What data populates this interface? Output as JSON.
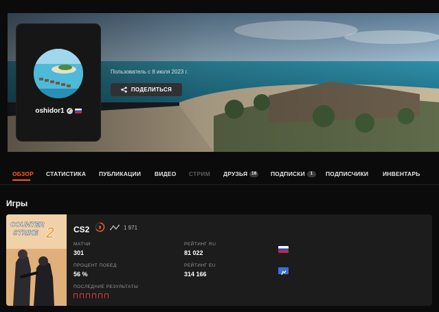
{
  "profile": {
    "username": "oshidor1",
    "member_since": "Пользователь с 8 июля 2023 г.",
    "share_label": "ПОДЕЛИТЬСЯ",
    "icons": [
      "verified-icon",
      "russia-flag-icon",
      "share-icon"
    ]
  },
  "tabs": [
    {
      "label": "ОБЗОР",
      "state": "active"
    },
    {
      "label": "СТАТИСТИКА",
      "state": "normal"
    },
    {
      "label": "ПУБЛИКАЦИИ",
      "state": "normal"
    },
    {
      "label": "ВИДЕО",
      "state": "normal"
    },
    {
      "label": "СТРИМ",
      "state": "disabled"
    },
    {
      "label": "ДРУЗЬЯ",
      "state": "normal",
      "badge": "16"
    },
    {
      "label": "ПОДПИСКИ",
      "state": "normal",
      "badge": "1"
    },
    {
      "label": "ПОДПИСЧИКИ",
      "state": "normal"
    },
    {
      "label": "ИНВЕНТАРЬ",
      "state": "normal"
    }
  ],
  "games_section": {
    "title": "Игры",
    "game": {
      "name": "CS2",
      "level": "9",
      "elo": "1 971",
      "stats": {
        "matches_label": "МАТЧИ",
        "matches_value": "301",
        "winrate_label": "ПРОЦЕНТ ПОБЕД",
        "winrate_value": "56 %",
        "rating_ru_label": "РЕЙТИНГ RU",
        "rating_ru_value": "81 022",
        "rating_eu_label": "РЕЙТИНГ EU",
        "rating_eu_value": "314 166",
        "recent_label": "ПОСЛЕДНИЕ РЕЗУЛЬТАТЫ",
        "recent_results": [
          "L",
          "L",
          "L",
          "L",
          "L",
          "L"
        ]
      }
    }
  },
  "colors": {
    "accent": "#ff5a1f",
    "loss": "#e0383a",
    "card": "#1c1c1c",
    "background": "#0b0b0b"
  }
}
